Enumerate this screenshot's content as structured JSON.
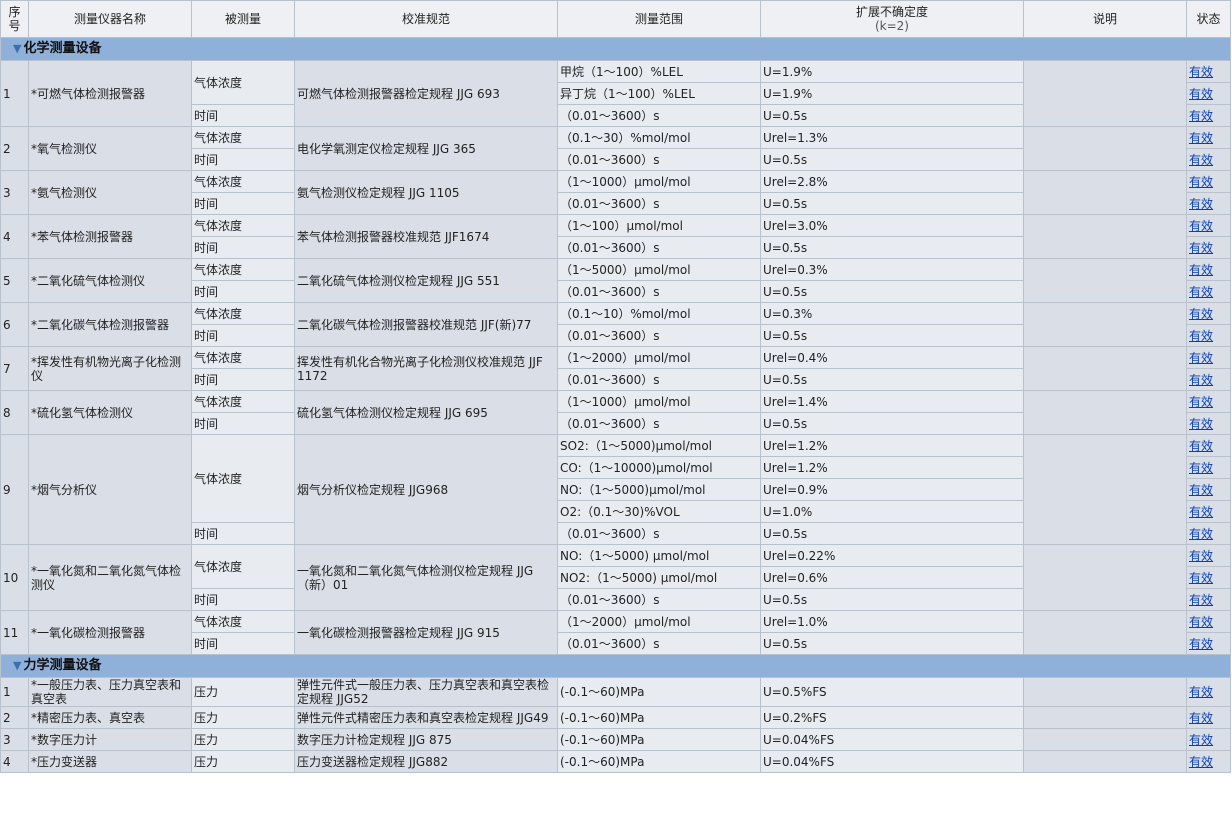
{
  "header": {
    "no": "序号",
    "name": "测量仪器名称",
    "quantity": "被测量",
    "spec": "校准规范",
    "range": "测量范围",
    "uncertainty_line1": "扩展不确定度",
    "uncertainty_line2": "(k=2)",
    "note": "说明",
    "status": "状态"
  },
  "sections": [
    {
      "title": "化学测量设备",
      "items": [
        {
          "no": "1",
          "name": "*可燃气体检测报警器",
          "spec": "可燃气体检测报警器检定规程 JJG 693",
          "rows": [
            {
              "q": "气体浓度",
              "range": "甲烷（1～100）%LEL",
              "unc": "U=1.9%"
            },
            {
              "q": "",
              "range": "异丁烷（1～100）%LEL",
              "unc": "U=1.9%"
            },
            {
              "q": "时间",
              "range": "（0.01～3600）s",
              "unc": "U=0.5s"
            }
          ]
        },
        {
          "no": "2",
          "name": "*氧气检测仪",
          "spec": "电化学氧测定仪检定规程 JJG 365",
          "rows": [
            {
              "q": "气体浓度",
              "range": "（0.1～30）%mol/mol",
              "unc": "Urel=1.3%"
            },
            {
              "q": "时间",
              "range": "（0.01～3600）s",
              "unc": "U=0.5s"
            }
          ]
        },
        {
          "no": "3",
          "name": "*氨气检测仪",
          "spec": "氨气检测仪检定规程 JJG 1105",
          "rows": [
            {
              "q": "气体浓度",
              "range": "（1～1000）μmol/mol",
              "unc": "Urel=2.8%"
            },
            {
              "q": "时间",
              "range": "（0.01～3600）s",
              "unc": "U=0.5s"
            }
          ]
        },
        {
          "no": "4",
          "name": "*苯气体检测报警器",
          "spec": "苯气体检测报警器校准规范 JJF1674",
          "rows": [
            {
              "q": "气体浓度",
              "range": "（1～100）μmol/mol",
              "unc": "Urel=3.0%"
            },
            {
              "q": "时间",
              "range": "（0.01～3600）s",
              "unc": "U=0.5s"
            }
          ]
        },
        {
          "no": "5",
          "name": "*二氧化硫气体检测仪",
          "spec": "二氧化硫气体检测仪检定规程 JJG 551",
          "rows": [
            {
              "q": "气体浓度",
              "range": "（1～5000）μmol/mol",
              "unc": "Urel=0.3%"
            },
            {
              "q": "时间",
              "range": "（0.01～3600）s",
              "unc": "U=0.5s"
            }
          ]
        },
        {
          "no": "6",
          "name": "*二氧化碳气体检测报警器",
          "spec": "二氧化碳气体检测报警器校准规范 JJF(新)77",
          "rows": [
            {
              "q": "气体浓度",
              "range": "（0.1～10）%mol/mol",
              "unc": "U=0.3%"
            },
            {
              "q": "时间",
              "range": "（0.01～3600）s",
              "unc": "U=0.5s"
            }
          ]
        },
        {
          "no": "7",
          "name": "*挥发性有机物光离子化检测仪",
          "spec": "挥发性有机化合物光离子化检测仪校准规范 JJF 1172",
          "rows": [
            {
              "q": "气体浓度",
              "range": "（1～2000）μmol/mol",
              "unc": "Urel=0.4%"
            },
            {
              "q": "时间",
              "range": "（0.01～3600）s",
              "unc": "U=0.5s"
            }
          ]
        },
        {
          "no": "8",
          "name": "*硫化氢气体检测仪",
          "spec": "硫化氢气体检测仪检定规程 JJG 695",
          "rows": [
            {
              "q": "气体浓度",
              "range": "（1～1000）μmol/mol",
              "unc": "Urel=1.4%"
            },
            {
              "q": "时间",
              "range": "（0.01～3600）s",
              "unc": "U=0.5s"
            }
          ]
        },
        {
          "no": "9",
          "name": "*烟气分析仪",
          "spec": "烟气分析仪检定规程 JJG968",
          "rows": [
            {
              "q": "气体浓度",
              "range": "SO2:（1～5000)μmol/mol",
              "unc": "Urel=1.2%"
            },
            {
              "q": "",
              "range": "CO:（1～10000)μmol/mol",
              "unc": "Urel=1.2%"
            },
            {
              "q": "",
              "range": "NO:（1～5000)μmol/mol",
              "unc": "Urel=0.9%"
            },
            {
              "q": "",
              "range": "O2:（0.1～30)%VOL",
              "unc": "U=1.0%"
            },
            {
              "q": "时间",
              "range": "（0.01～3600）s",
              "unc": "U=0.5s"
            }
          ]
        },
        {
          "no": "10",
          "name": "*一氧化氮和二氧化氮气体检测仪",
          "spec": "一氧化氮和二氧化氮气体检测仪检定规程 JJG（新）01",
          "rows": [
            {
              "q": "气体浓度",
              "range": "NO:（1～5000) μmol/mol",
              "unc": "Urel=0.22%"
            },
            {
              "q": "",
              "range": "NO2:（1～5000) μmol/mol",
              "unc": "Urel=0.6%"
            },
            {
              "q": "时间",
              "range": "（0.01～3600）s",
              "unc": "U=0.5s"
            }
          ]
        },
        {
          "no": "11",
          "name": "*一氧化碳检测报警器",
          "spec": "一氧化碳检测报警器检定规程 JJG 915",
          "rows": [
            {
              "q": "气体浓度",
              "range": "（1～2000）μmol/mol",
              "unc": "Urel=1.0%"
            },
            {
              "q": "时间",
              "range": "（0.01～3600）s",
              "unc": "U=0.5s"
            }
          ]
        }
      ]
    },
    {
      "title": "力学测量设备",
      "items": [
        {
          "no": "1",
          "name": "*一般压力表、压力真空表和真空表",
          "spec": "弹性元件式一般压力表、压力真空表和真空表检定规程 JJG52",
          "rows": [
            {
              "q": "压力",
              "range": "(-0.1～60)MPa",
              "unc": "U=0.5%FS"
            }
          ]
        },
        {
          "no": "2",
          "name": "*精密压力表、真空表",
          "spec": "弹性元件式精密压力表和真空表检定规程 JJG49",
          "rows": [
            {
              "q": "压力",
              "range": "(-0.1～60)MPa",
              "unc": "U=0.2%FS"
            }
          ]
        },
        {
          "no": "3",
          "name": "*数字压力计",
          "spec": "数字压力计检定规程 JJG 875",
          "rows": [
            {
              "q": "压力",
              "range": "(-0.1～60)MPa",
              "unc": "U=0.04%FS"
            }
          ]
        },
        {
          "no": "4",
          "name": "*压力变送器",
          "spec": "压力变送器检定规程 JJG882",
          "rows": [
            {
              "q": "压力",
              "range": "(-0.1～60)MPa",
              "unc": "U=0.04%FS"
            }
          ]
        }
      ]
    }
  ],
  "status_link": "有效",
  "colors": {
    "header_bg": "#eef0f3",
    "section_bg": "#8fb0d8",
    "row_bg": "#d9dee7",
    "link": "#0a3fb0"
  }
}
